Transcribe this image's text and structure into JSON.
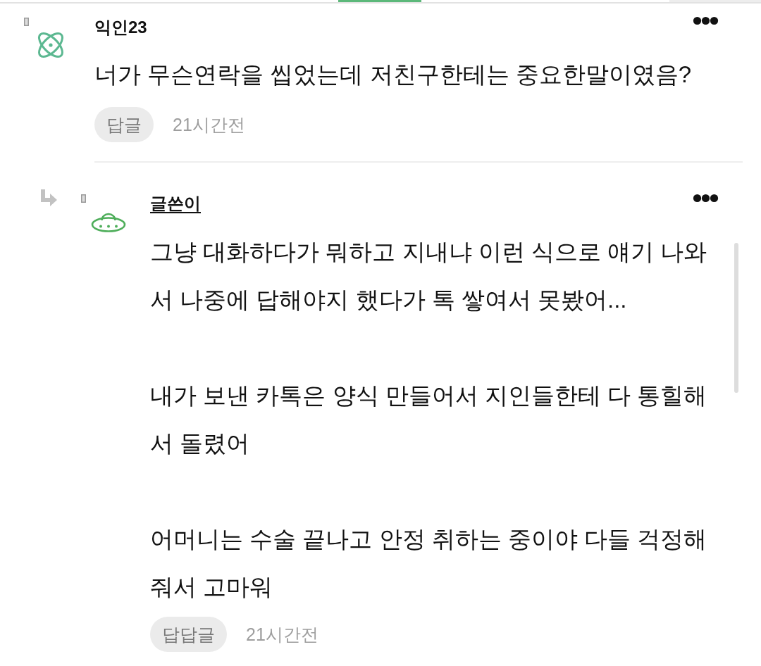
{
  "comments": [
    {
      "kind": "comment",
      "author": "익인23",
      "is_writer": false,
      "body": [
        "너가 무슨연락을 씹었는데 저친구한테는 중요한말이였음?"
      ],
      "reply_label": "답글",
      "time": "21시간전"
    },
    {
      "kind": "reply",
      "author": "글쓴이",
      "is_writer": true,
      "body": [
        "그냥 대화하다가 뭐하고 지내냐 이런 식으로 얘기 나와서 나중에 답해야지 했다가 톡 쌓여서 못봤어...",
        "내가 보낸 카톡은 양식 만들어서 지인들한테 다 통힐해서 돌렸어",
        "어머니는 수술 끝나고 안정 취하는 중이야 다들 걱정해줘서 고마워"
      ],
      "reply_label": "답답글",
      "time": "21시간전"
    }
  ]
}
